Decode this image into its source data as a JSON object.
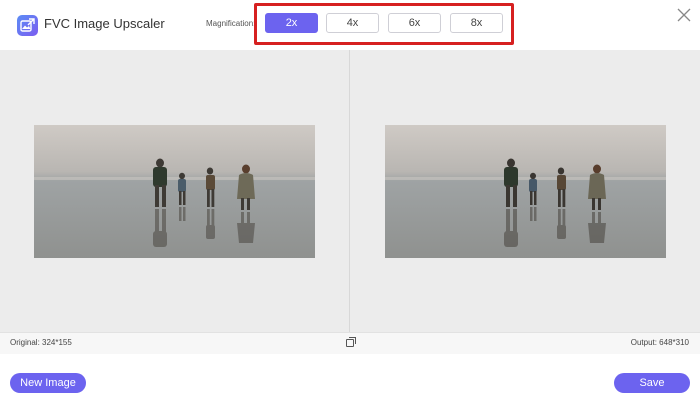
{
  "app": {
    "title": "FVC Image Upscaler",
    "accent_color": "#6c63ef",
    "logo_icon": "image-upscaler-logo-icon"
  },
  "magnification": {
    "label": "Magnification:",
    "options": [
      "2x",
      "4x",
      "6x",
      "8x"
    ],
    "selected": "2x",
    "highlight_color": "#d62020"
  },
  "window": {
    "close_icon": "close-icon"
  },
  "preview": {
    "original_label": "Original: 324*155",
    "output_label": "Output: 648*310",
    "compare_icon": "compare-icon"
  },
  "footer": {
    "new_image_label": "New Image",
    "save_label": "Save"
  }
}
